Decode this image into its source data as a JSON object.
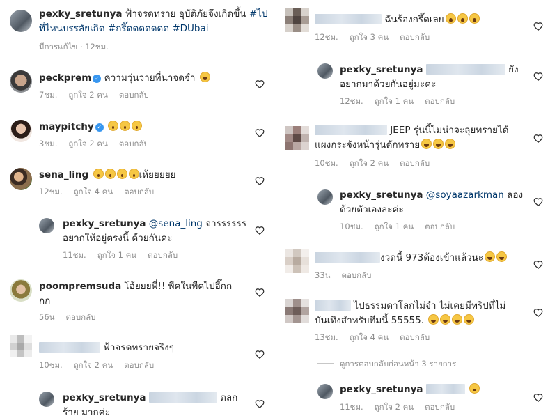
{
  "caption": {
    "username": "pexky_sretunya",
    "text": "ฟ้าจรดทราย  อุบัติภัยจึงเกิดขึ้น",
    "tag1": "#ไปที่ไหนบรรลัยเกิด",
    "tag2": "#กรี๊ดดดดดดด",
    "tag3": "#DUbai",
    "edited": "มีการแก้ไข · 12ชม."
  },
  "left": [
    {
      "username": "peckprem",
      "text": "ความวุ่นวายที่น่าจดจำ",
      "time": "7ชม.",
      "likes": "ถูกใจ 2 คน",
      "reply": "ตอบกลับ"
    },
    {
      "username": "maypitchy",
      "text": "",
      "time": "3ชม.",
      "likes": "ถูกใจ 2 คน",
      "reply": "ตอบกลับ"
    },
    {
      "username": "sena_ling",
      "text": "เห้ยยยยย",
      "time": "12ชม.",
      "likes": "ถูกใจ 4 คน",
      "reply": "ตอบกลับ"
    },
    {
      "username": "pexky_sretunya",
      "mention": "@sena_ling",
      "text1": " จารรรรรร",
      "text2": "อยากให้อยู่ตรงนี้ ด้วยกันค่ะ",
      "time": "11ชม.",
      "likes": "ถูกใจ 1 คน",
      "reply": "ตอบกลับ"
    },
    {
      "username": "poompremsuda",
      "text1": " โอ้ยยยพี่!! พีคในพีคไปอี๊กก",
      "text2": "กก",
      "time": "56น",
      "reply": "ตอบกลับ"
    },
    {
      "text": "ฟ้าจรดทรายจริงๆ",
      "time": "10ชม.",
      "likes": "ถูกใจ 2 คน",
      "reply": "ตอบกลับ"
    },
    {
      "username": "pexky_sretunya",
      "text1": " ตลก",
      "text2": "ร้าย มากค่ะ"
    }
  ],
  "right": [
    {
      "text": "ฉันร้องกรี๊ดเลย",
      "time": "12ชม.",
      "likes": "ถูกใจ 3 คน",
      "reply": "ตอบกลับ"
    },
    {
      "username": "pexky_sretunya",
      "text1": " ยัง",
      "text2": "อยากมาด้วยกันอยู่มะคะ",
      "time": "12ชม.",
      "likes": "ถูกใจ 1 คน",
      "reply": "ตอบกลับ"
    },
    {
      "text1": " JEEP รุ่นนี้ไม่น่าจะลุยทรายได้",
      "text2": "แผงกระจังหน้ารุ่นดักทราย",
      "time": "10ชม.",
      "likes": "ถูกใจ 2 คน",
      "reply": "ตอบกลับ"
    },
    {
      "username": "pexky_sretunya",
      "mention": "@soyaazarkman",
      "text1": "  ลอง",
      "text2": "ด้วยตัวเองละค่ะ",
      "time": "10ชม.",
      "likes": "ถูกใจ 1 คน",
      "reply": "ตอบกลับ"
    },
    {
      "text": "งวดนี้ 973ต้องเข้าแล้วนะ",
      "time": "33น",
      "reply": "ตอบกลับ"
    },
    {
      "text1": " ไปธรรมดาโลกไม่จำ ไม่เคยมีทริปที่ไม่",
      "text2": "บันเทิงสำหรับทีมนี้ 55555.",
      "time": "13ชม.",
      "likes": "ถูกใจ 4 คน",
      "reply": "ตอบกลับ"
    },
    {
      "view_replies": "ดูการตอบกลับก่อนหน้า 3 รายการ"
    },
    {
      "username": "pexky_sretunya",
      "time": "11ชม.",
      "likes": "ถูกใจ 2 คน",
      "reply": "ตอบกลับ"
    }
  ],
  "icons": {
    "heart": "heart-outline-icon",
    "verified": "verified-badge-icon",
    "emoji": "emoji-icon"
  },
  "colors": {
    "link": "#00376b",
    "meta": "#8e8e8e",
    "verified": "#3897f0",
    "text": "#262626"
  }
}
